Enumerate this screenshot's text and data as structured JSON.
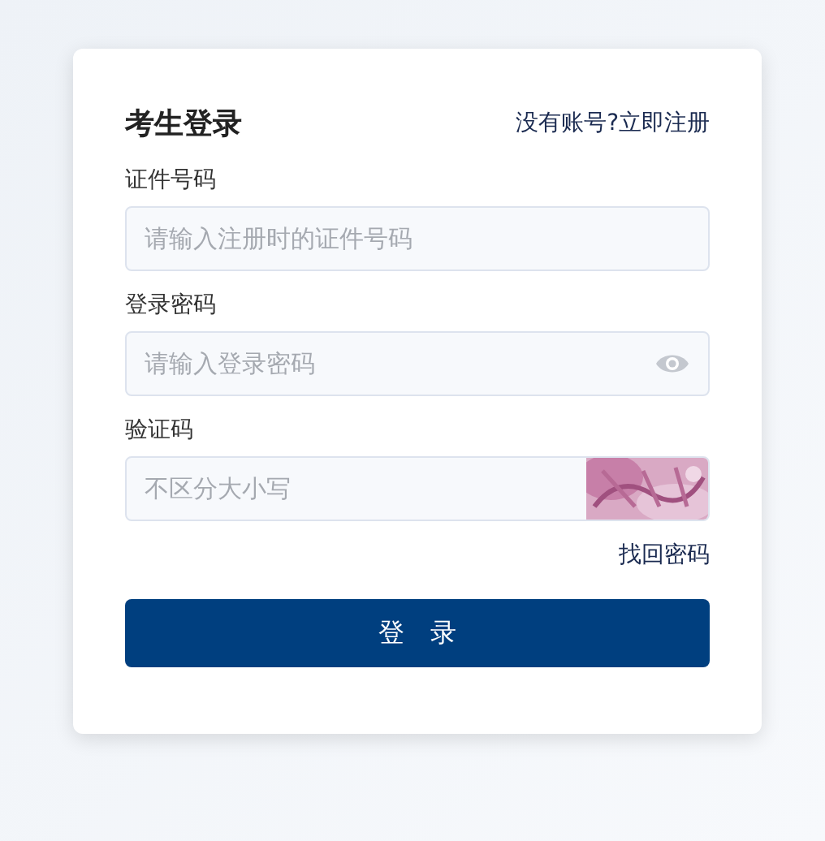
{
  "title": "考生登录",
  "register_link": "没有账号?立即注册",
  "fields": [
    {
      "label": "证件号码",
      "placeholder": "请输入注册时的证件号码",
      "kind": "text"
    },
    {
      "label": "登录密码",
      "placeholder": "请输入登录密码",
      "kind": "password"
    },
    {
      "label": "验证码",
      "placeholder": "不区分大小写",
      "kind": "captcha"
    }
  ],
  "forgot_link": "找回密码",
  "submit": "登　录"
}
